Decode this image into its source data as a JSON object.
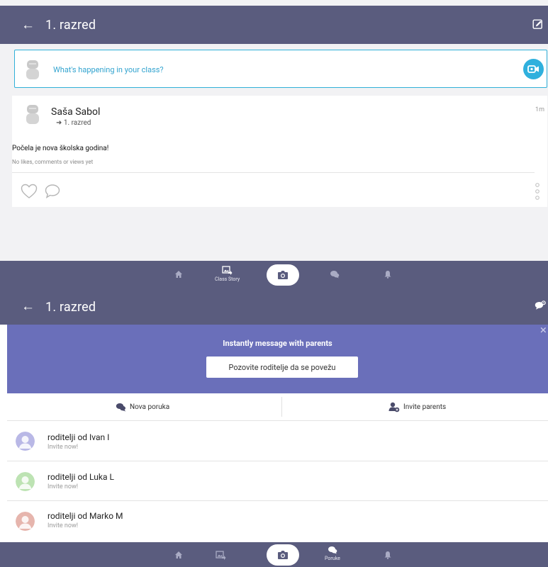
{
  "class_story_screen": {
    "appbar": {
      "back_glyph": "←",
      "title": "1. razred",
      "right_icon": "edit-icon"
    },
    "composer": {
      "placeholder": "What's happening in your class?",
      "action_icon": "video-camera-icon"
    },
    "post": {
      "author": "Saša Sabol",
      "target": "➜ 1. razred",
      "time": "1m",
      "text": "Počela je nova školska godina!",
      "meta": "No likes, comments or views yet"
    },
    "bottom_nav": {
      "active_label": "Class Story"
    }
  },
  "messages_screen": {
    "appbar": {
      "back_glyph": "←",
      "title": "1. razred",
      "right_icon": "chat-settings-icon"
    },
    "banner": {
      "title": "Instantly message with parents",
      "button_label": "Pozovite roditelje da se povežu",
      "close_glyph": "×"
    },
    "actions": {
      "new_message": "Nova poruka",
      "invite_parents": "Invite parents"
    },
    "parents": [
      {
        "name": "roditelji od Ivan I",
        "sub": "Invite now!",
        "color": "#b9b8e6"
      },
      {
        "name": "roditelji od Luka L",
        "sub": "Invite now!",
        "color": "#bde3b3"
      },
      {
        "name": "roditelji od Marko M",
        "sub": "Invite now!",
        "color": "#e6b5ad"
      }
    ],
    "bottom_nav": {
      "active_label": "Poruke"
    }
  },
  "colors": {
    "appbar": "#5a5c7e",
    "banner": "#6a6fba",
    "accent": "#2fb0dd"
  }
}
